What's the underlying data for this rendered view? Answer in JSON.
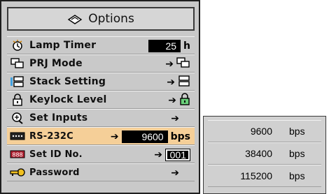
{
  "title": "Options",
  "items": [
    {
      "label": "Lamp Timer",
      "icon": "lamp-timer-icon",
      "value": "25",
      "unit": "h"
    },
    {
      "label": "PRJ Mode",
      "icon": "prj-mode-icon",
      "arrow": "➔"
    },
    {
      "label": "Stack Setting",
      "icon": "stack-setting-icon",
      "arrow": "➔"
    },
    {
      "label": "Keylock Level",
      "icon": "keylock-icon",
      "arrow": "➔"
    },
    {
      "label": "Set Inputs",
      "icon": "set-inputs-icon",
      "arrow": "➔"
    },
    {
      "label": "RS-232C",
      "icon": "rs232c-icon",
      "arrow": "➔",
      "value": "9600",
      "unit": "bps",
      "selected": true
    },
    {
      "label": "Set ID No.",
      "icon": "set-id-icon",
      "arrow": "➔",
      "value": "001"
    },
    {
      "label": "Password",
      "icon": "password-key-icon",
      "arrow": "➔"
    }
  ],
  "baud_options": [
    {
      "value": "9600",
      "unit": "bps"
    },
    {
      "value": "38400",
      "unit": "bps"
    },
    {
      "value": "115200",
      "unit": "bps"
    }
  ],
  "colors": {
    "panel": "#c9c9c9",
    "highlight": "#f5cf98",
    "value_box": "#000000"
  }
}
